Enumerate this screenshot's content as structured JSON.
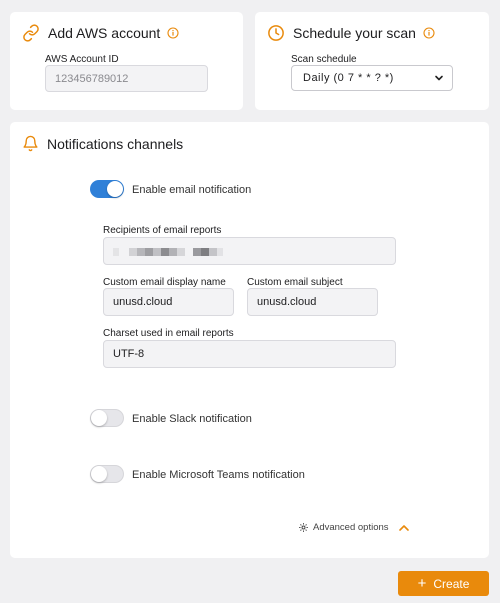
{
  "aws_card": {
    "title": "Add AWS account",
    "account_id_label": "AWS Account ID",
    "account_id_placeholder": "123456789012"
  },
  "schedule_card": {
    "title": "Schedule your scan",
    "schedule_label": "Scan schedule",
    "schedule_value": "Daily (0 7 * * ? *)"
  },
  "notifications": {
    "title": "Notifications channels",
    "email": {
      "toggle_label": "Enable email notification",
      "enabled": true,
      "recipients_label": "Recipients of email reports",
      "display_name_label": "Custom email display name",
      "display_name_value": "unusd.cloud",
      "subject_label": "Custom email subject",
      "subject_value": "unusd.cloud",
      "charset_label": "Charset used in email reports",
      "charset_value": "UTF-8"
    },
    "slack": {
      "toggle_label": "Enable Slack notification",
      "enabled": false
    },
    "teams": {
      "toggle_label": "Enable Microsoft Teams notification",
      "enabled": false
    },
    "advanced_label": "Advanced options"
  },
  "create_button": {
    "label": "Create"
  },
  "colors": {
    "accent": "#e98a0c",
    "toggle_on": "#2f80d8"
  },
  "icons": {
    "aws_card": "link-icon",
    "schedule_card": "clock-icon",
    "notifications": "bell-icon",
    "info": "info-icon",
    "select": "chevron-down-icon",
    "advanced": "gear-icon",
    "advanced_toggle": "chevron-up-icon"
  }
}
